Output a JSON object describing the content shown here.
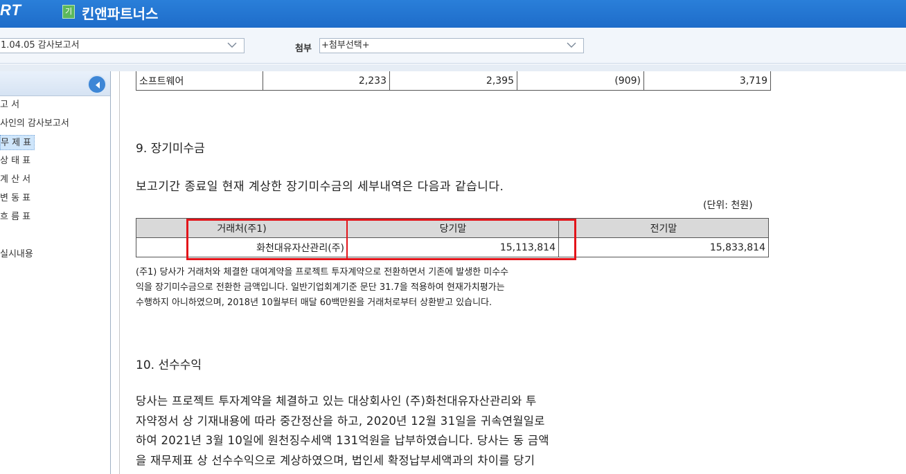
{
  "header": {
    "logo": "RT",
    "badge": "기",
    "company": "킨앤파트너스"
  },
  "toolbar": {
    "report_select": "1.04.05  감사보고서",
    "attach_label": "첨부",
    "attach_select": "+첨부선택+"
  },
  "sidebar": {
    "items": [
      {
        "label": "고 서"
      },
      {
        "label": "사인의 감사보고서"
      },
      {
        "label": "무 제 표"
      },
      {
        "label": "상 태 표"
      },
      {
        "label": "계 산 서"
      },
      {
        "label": "변 동 표"
      },
      {
        "label": "흐 름 표"
      },
      {
        "label": "실시내용"
      }
    ]
  },
  "content": {
    "prev_row": {
      "label": "소프트웨어",
      "c1": "2,233",
      "c2": "2,395",
      "c3": "(909)",
      "c4": "3,719"
    },
    "section9_title": "9.  장기미수금",
    "section9_intro": "보고기간 종료일 현재 계상한 장기미수금의 세부내역은 다음과 같습니다.",
    "unit": "(단위: 천원)",
    "table": {
      "headers": [
        "거래처(주1)",
        "당기말",
        "전기말"
      ],
      "row": {
        "name": "화천대유자산관리(주)",
        "current": "15,113,814",
        "prior": "15,833,814"
      }
    },
    "note_lines": [
      "(주1) 당사가 거래처와 체결한 대여계약을 프로젝트 투자계약으로 전환하면서 기존에 발생한 미수수",
      "익을 장기미수금으로 전환한 금액입니다. 일반기업회계기준 문단  31.7을 적용하여 현재가치평가는",
      "수행하지 아니하였으며, 2018년 10월부터  매달   60백만원을 거래처로부터 상환받고 있습니다."
    ],
    "section10_title": "10. 선수수익",
    "section10_lines": [
      "당사는 프로젝트 투자계약을 체결하고 있는 대상회사인 (주)화천대유자산관리와 투",
      "자약정서 상 기재내용에 따라 중간정산을 하고, 2020년 12월 31일을 귀속연월일로",
      "하여 2021년 3월 10일에 원천징수세액 131억원을 납부하였습니다. 당사는 동 금액",
      "을 재무제표 상 선수수익으로 계상하였으며, 법인세 확정납부세액과의 차이를 당기"
    ]
  },
  "colors": {
    "header": "#1e6cc9",
    "highlight": "#e3141a",
    "table_head": "#d9d9d9"
  }
}
